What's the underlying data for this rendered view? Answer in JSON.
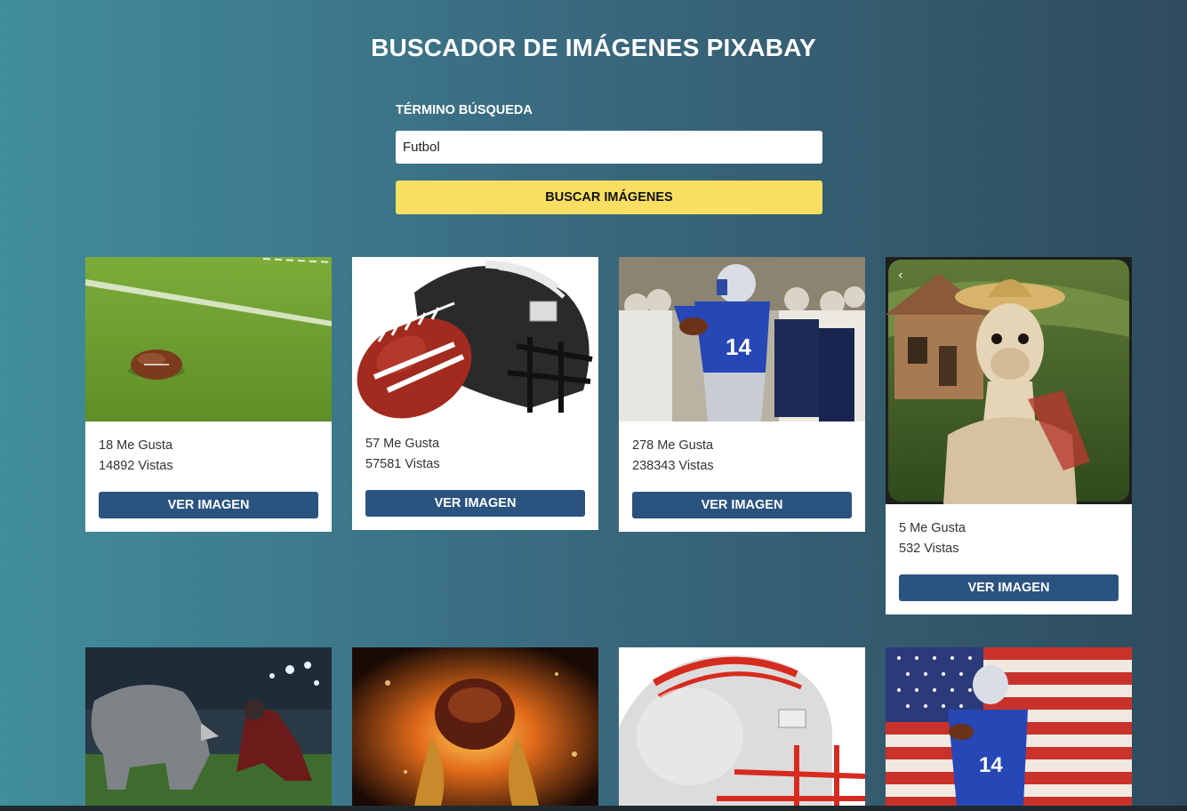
{
  "header": {
    "title": "BUSCADOR DE IMÁGENES PIXABAY"
  },
  "search": {
    "label": "TÉRMINO BÚSQUEDA",
    "value": "Futbol",
    "button_label": "BUSCAR IMÁGENES"
  },
  "results": [
    {
      "image": "football-on-field-image",
      "likes_text": "18 Me Gusta",
      "views_text": "14892 Vistas",
      "button_label": "VER IMAGEN"
    },
    {
      "image": "football-and-helmet-image",
      "likes_text": "57 Me Gusta",
      "views_text": "57581 Vistas",
      "button_label": "VER IMAGEN"
    },
    {
      "image": "quarterback-throwing-image",
      "likes_text": "278 Me Gusta",
      "views_text": "238343 Vistas",
      "button_label": "VER IMAGEN"
    },
    {
      "image": "llama-with-sombrero-image",
      "likes_text": "5 Me Gusta",
      "views_text": "532 Vistas",
      "button_label": "VER IMAGEN"
    },
    {
      "image": "rhino-vs-player-image"
    },
    {
      "image": "player-in-flames-image"
    },
    {
      "image": "white-red-helmet-image"
    },
    {
      "image": "quarterback-us-flag-image"
    }
  ],
  "colors": {
    "background_start": "#418d9c",
    "background_end": "#2f4c5e",
    "search_button": "#f8df62",
    "view_button": "#2b5380"
  }
}
